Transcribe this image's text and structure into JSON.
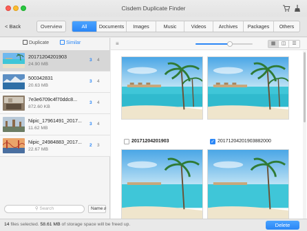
{
  "window": {
    "title": "Cisdem Duplicate Finder",
    "icons": [
      "cart-icon",
      "broom-icon"
    ]
  },
  "toolbar": {
    "back_label": "< Back",
    "overview_label": "Overview",
    "tabs": [
      {
        "label": "All",
        "active": true
      },
      {
        "label": "Documents",
        "active": false
      },
      {
        "label": "Images",
        "active": false
      },
      {
        "label": "Music",
        "active": false
      },
      {
        "label": "Videos",
        "active": false
      },
      {
        "label": "Archives",
        "active": false
      },
      {
        "label": "Packages",
        "active": false
      },
      {
        "label": "Others",
        "active": false
      }
    ]
  },
  "sidebar": {
    "modes": {
      "duplicate": "Duplicate",
      "similar": "Similar",
      "active": "similar"
    },
    "items": [
      {
        "name": "20171204201903",
        "size": "24.90 MB",
        "count_a": "3",
        "count_b": "4",
        "selected": true
      },
      {
        "name": "500342831",
        "size": "20.63 MB",
        "count_a": "3",
        "count_b": "4",
        "selected": false
      },
      {
        "name": "7e3e6709c4f70ddc8...",
        "size": "872.60 KB",
        "count_a": "3",
        "count_b": "4",
        "selected": false
      },
      {
        "name": "Nipic_17961491_2017...",
        "size": "11.62 MB",
        "count_a": "3",
        "count_b": "4",
        "selected": false
      },
      {
        "name": "Nipic_24984883_2017...",
        "size": "22.67 MB",
        "count_a": "2",
        "count_b": "3",
        "selected": false
      }
    ],
    "search": {
      "placeholder": "Search"
    },
    "sort": {
      "label": "Name"
    }
  },
  "main": {
    "slider_value": 0.6,
    "view_modes": [
      "grid",
      "compare",
      "list"
    ],
    "active_view": "grid",
    "cards": [
      {
        "label": "20171204201903",
        "checked": false,
        "bold": true
      },
      {
        "label": "2017120420190388200​0",
        "checked": true,
        "bold": false
      },
      {
        "label": "",
        "checked": false,
        "bold": false
      },
      {
        "label": "",
        "checked": false,
        "bold": false
      }
    ]
  },
  "status": {
    "files_selected": "14",
    "files_label": "files selected.",
    "freed_size": "58.61 MB",
    "freed_label": "of storage space will be freed up.",
    "delete_label": "Delete"
  },
  "colors": {
    "accent": "#2a86f6",
    "sea": "#3fc6d8",
    "sky": "#4aa6e6"
  }
}
